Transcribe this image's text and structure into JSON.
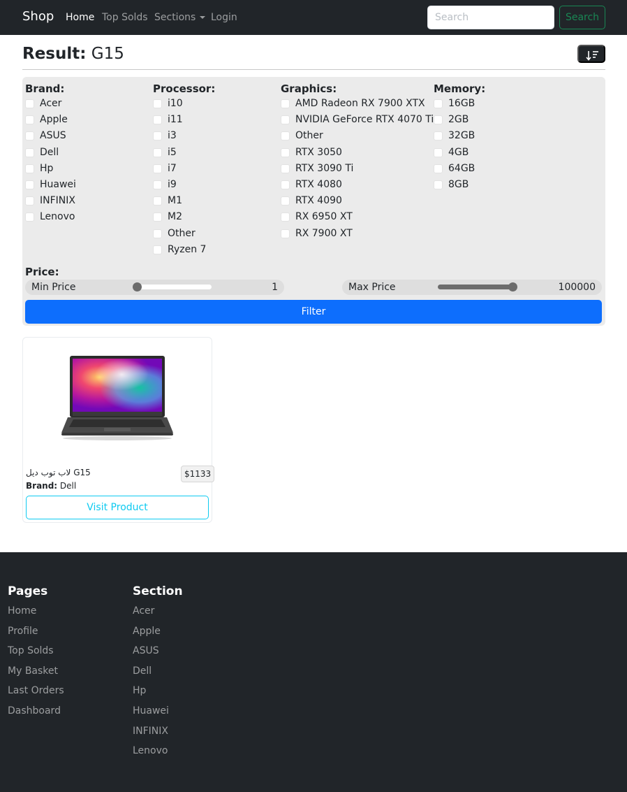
{
  "navbar": {
    "brand": "Shop",
    "links": [
      "Home",
      "Top Solds",
      "Sections",
      "Login"
    ],
    "search_placeholder": "Search",
    "search_button": "Search"
  },
  "result": {
    "label": "Result:",
    "query": "G15",
    "sort_icon": "sort-descending-icon"
  },
  "filters": {
    "brand": {
      "title": "Brand:",
      "options": [
        "Acer",
        "Apple",
        "ASUS",
        "Dell",
        "Hp",
        "Huawei",
        "INFINIX",
        "Lenovo"
      ]
    },
    "processor": {
      "title": "Processor:",
      "options": [
        "i10",
        "i11",
        "i3",
        "i5",
        "i7",
        "i9",
        "M1",
        "M2",
        "Other",
        "Ryzen 7"
      ]
    },
    "graphics": {
      "title": "Graphics:",
      "options": [
        "AMD Radeon RX 7900 XTX",
        "NVIDIA GeForce RTX 4070 Ti",
        "Other",
        "RTX 3050",
        "RTX 3090 Ti",
        "RTX 4080",
        "RTX 4090",
        "RX 6950 XT",
        "RX 7900 XT"
      ]
    },
    "memory": {
      "title": "Memory:",
      "options": [
        "16GB",
        "2GB",
        "32GB",
        "4GB",
        "64GB",
        "8GB"
      ]
    },
    "price": {
      "title": "Price:",
      "min_label": "Min Price",
      "min_value": "1",
      "min_fraction": 0.0,
      "max_label": "Max Price",
      "max_value": "100000",
      "max_fraction": 1.0
    },
    "filter_button": "Filter"
  },
  "products": [
    {
      "name": "لاب توب ديل G15",
      "price": "$1133",
      "brand_label": "Brand:",
      "brand": "Dell",
      "button": "Visit Product"
    }
  ],
  "footer": {
    "pages": {
      "title": "Pages",
      "links": [
        "Home",
        "Profile",
        "Top Solds",
        "My Basket",
        "Last Orders",
        "Dashboard"
      ]
    },
    "section": {
      "title": "Section",
      "links": [
        "Acer",
        "Apple",
        "ASUS",
        "Dell",
        "Hp",
        "Huawei",
        "INFINIX",
        "Lenovo"
      ]
    }
  },
  "colors": {
    "navbar_bg": "#212529",
    "primary": "#0d6efd",
    "success": "#198754",
    "info": "#0dcaf0",
    "panel_bg": "#ebebeb"
  }
}
